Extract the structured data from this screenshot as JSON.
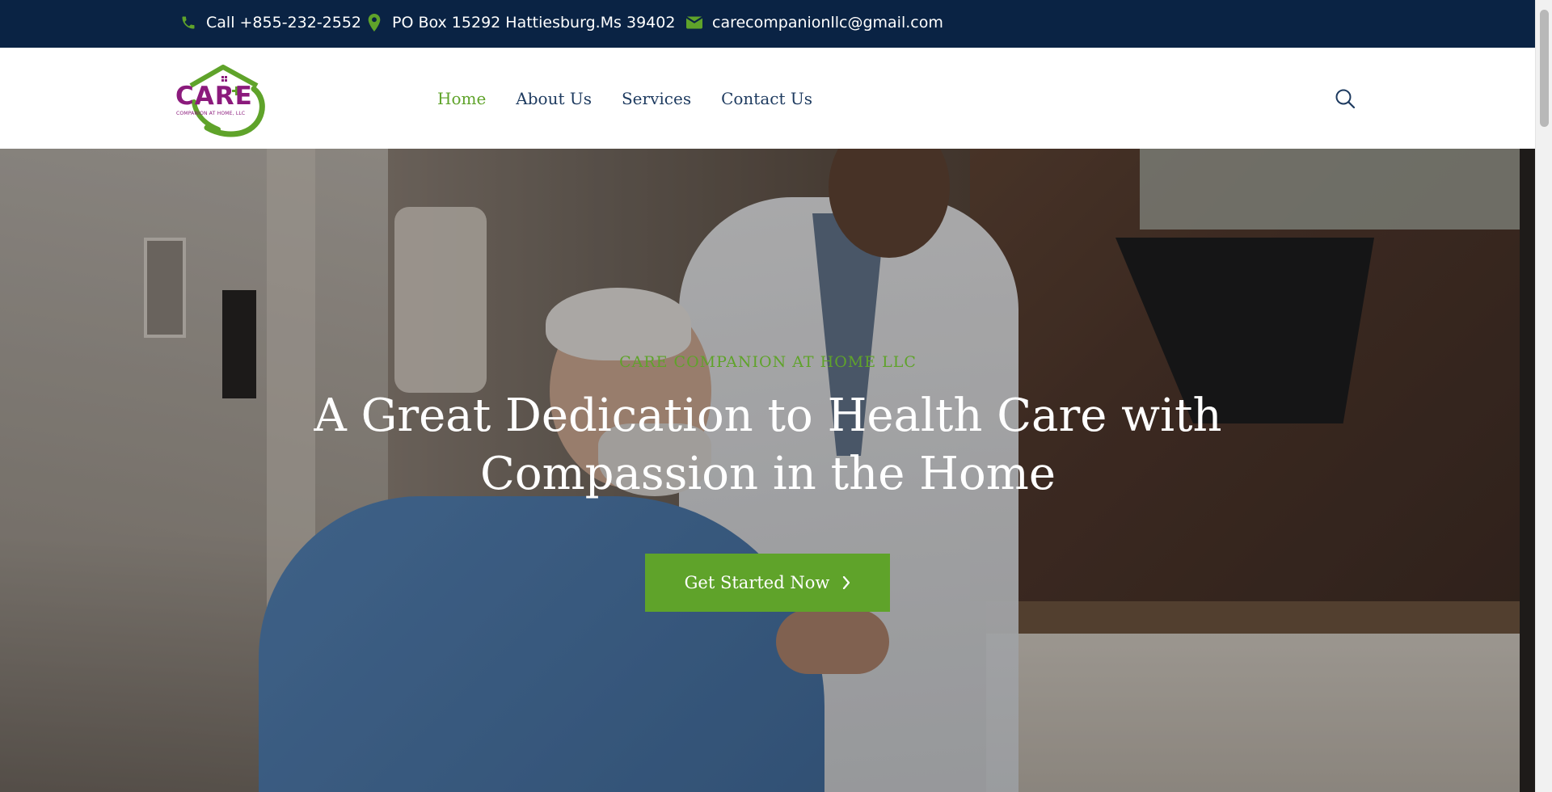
{
  "topbar": {
    "phone": "Call +855-232-2552",
    "address": "PO Box 15292 Hattiesburg.Ms 39402",
    "email": "carecompanionllc@gmail.com",
    "icons": [
      "phone-icon",
      "map-pin-icon",
      "envelope-icon"
    ],
    "icon_color": "#5fa32a",
    "background": "#0a2344"
  },
  "logo": {
    "word": "CARE",
    "subtitle": "COMPANION AT HOME, LLC"
  },
  "nav": {
    "items": [
      {
        "label": "Home",
        "active": true
      },
      {
        "label": "About Us",
        "active": false
      },
      {
        "label": "Services",
        "active": false
      },
      {
        "label": "Contact Us",
        "active": false
      }
    ],
    "search_icon": "search-icon"
  },
  "hero": {
    "kicker": "CARE COMPANION AT HOME LLC",
    "title_line1": "A Great Dedication to Health Care with",
    "title_line2": "Compassion in the Home",
    "cta_label": "Get Started Now",
    "cta_color": "#5fa32a"
  },
  "theme": {
    "accent": "#5fa32a",
    "brand_purple": "#8b1a7c",
    "nav_text": "#1d3a5f"
  }
}
